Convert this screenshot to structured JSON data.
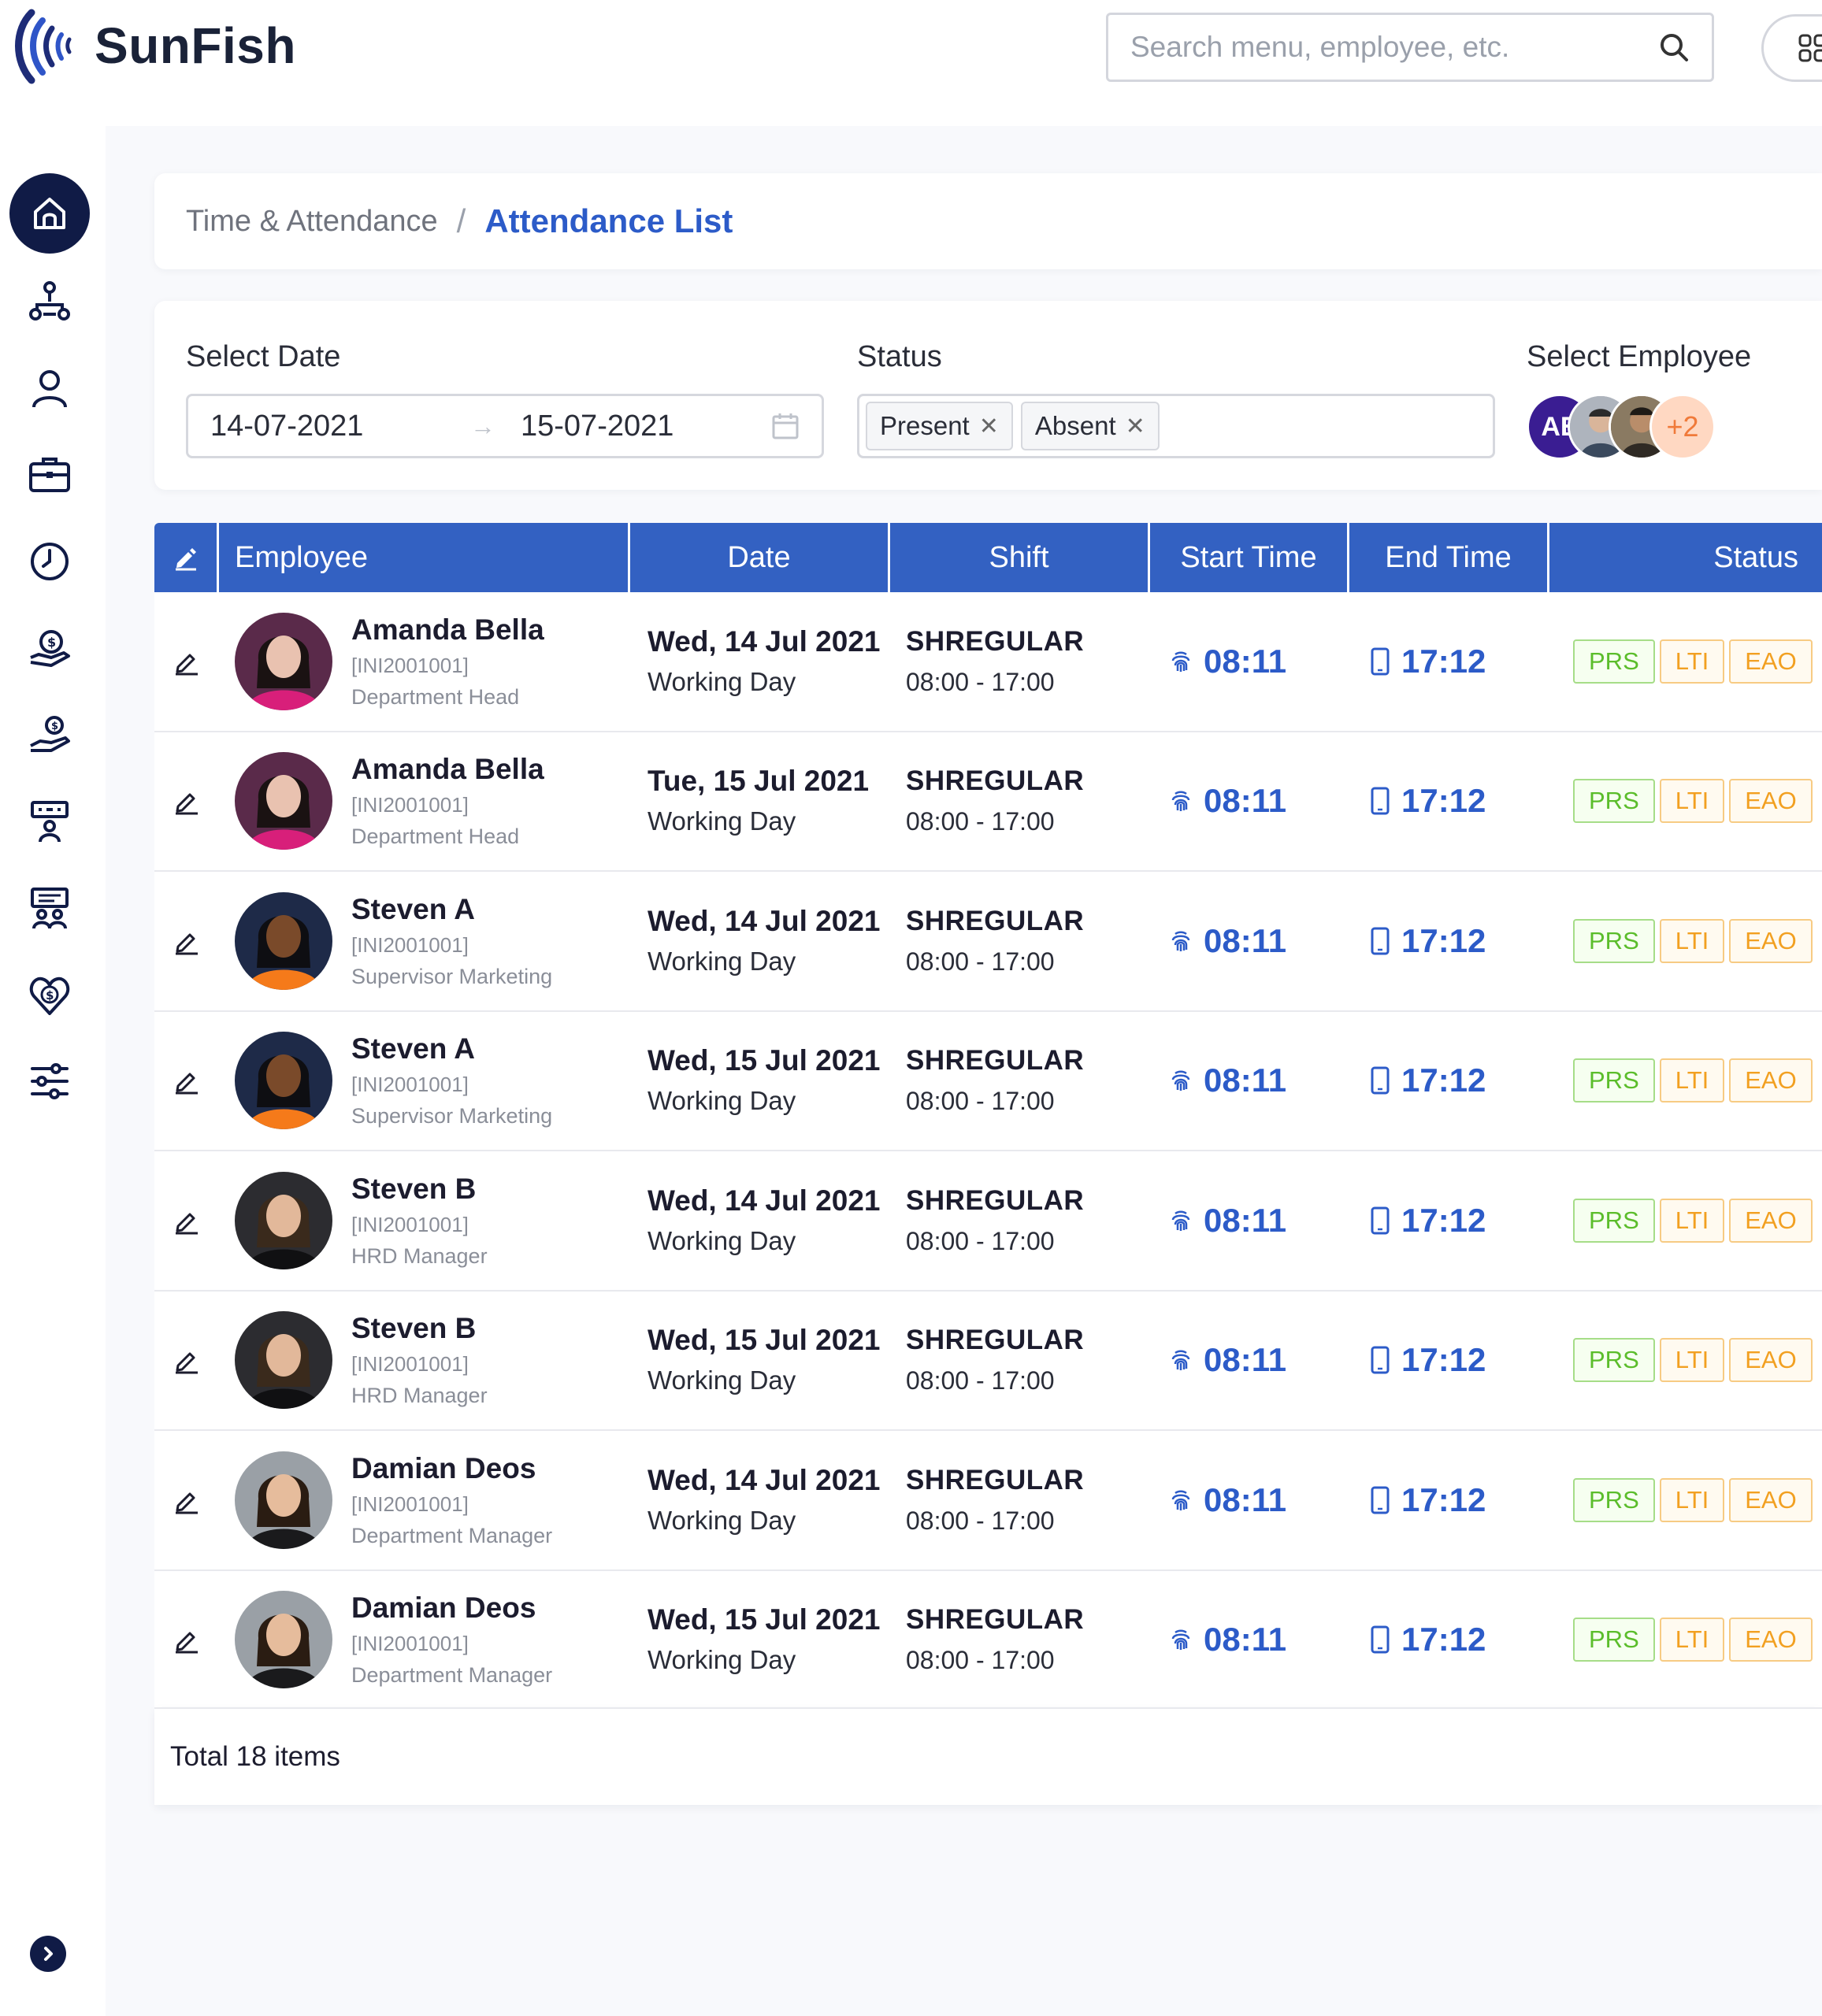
{
  "app": {
    "name": "SunFish"
  },
  "search": {
    "placeholder": "Search menu, employee, etc."
  },
  "breadcrumb": {
    "parent": "Time & Attendance",
    "separator": "/",
    "current": "Attendance List"
  },
  "filters": {
    "date_label": "Select Date",
    "date_from": "14-07-2021",
    "date_to": "15-07-2021",
    "status_label": "Status",
    "status_tags": [
      "Present",
      "Absent"
    ],
    "employee_label": "Select Employee",
    "employee_initials": "AE",
    "employee_more": "+2"
  },
  "table": {
    "headers": {
      "employee": "Employee",
      "date": "Date",
      "shift": "Shift",
      "start": "Start Time",
      "end": "End Time",
      "status": "Status"
    },
    "rows": [
      {
        "name": "Amanda Bella",
        "id": "[INI2001001]",
        "role": "Department Head",
        "date": "Wed, 14 Jul 2021",
        "day_type": "Working Day",
        "shift": "SHREGULAR",
        "shift_hours": "08:00 - 17:00",
        "start": "08:11",
        "end": "17:12",
        "badges": [
          "PRS",
          "LTI",
          "EAO"
        ]
      },
      {
        "name": "Amanda Bella",
        "id": "[INI2001001]",
        "role": "Department Head",
        "date": "Tue, 15 Jul 2021",
        "day_type": "Working Day",
        "shift": "SHREGULAR",
        "shift_hours": "08:00 - 17:00",
        "start": "08:11",
        "end": "17:12",
        "badges": [
          "PRS",
          "LTI",
          "EAO"
        ]
      },
      {
        "name": "Steven A",
        "id": "[INI2001001]",
        "role": "Supervisor Marketing",
        "date": "Wed, 14 Jul 2021",
        "day_type": "Working Day",
        "shift": "SHREGULAR",
        "shift_hours": "08:00 - 17:00",
        "start": "08:11",
        "end": "17:12",
        "badges": [
          "PRS",
          "LTI",
          "EAO"
        ]
      },
      {
        "name": "Steven A",
        "id": "[INI2001001]",
        "role": "Supervisor Marketing",
        "date": "Wed, 15 Jul 2021",
        "day_type": "Working Day",
        "shift": "SHREGULAR",
        "shift_hours": "08:00 - 17:00",
        "start": "08:11",
        "end": "17:12",
        "badges": [
          "PRS",
          "LTI",
          "EAO"
        ]
      },
      {
        "name": "Steven B",
        "id": "[INI2001001]",
        "role": "HRD Manager",
        "date": "Wed, 14 Jul 2021",
        "day_type": "Working Day",
        "shift": "SHREGULAR",
        "shift_hours": "08:00 - 17:00",
        "start": "08:11",
        "end": "17:12",
        "badges": [
          "PRS",
          "LTI",
          "EAO"
        ]
      },
      {
        "name": "Steven B",
        "id": "[INI2001001]",
        "role": "HRD Manager",
        "date": "Wed, 15 Jul 2021",
        "day_type": "Working Day",
        "shift": "SHREGULAR",
        "shift_hours": "08:00 - 17:00",
        "start": "08:11",
        "end": "17:12",
        "badges": [
          "PRS",
          "LTI",
          "EAO"
        ]
      },
      {
        "name": "Damian Deos",
        "id": "[INI2001001]",
        "role": "Department Manager",
        "date": "Wed, 14 Jul 2021",
        "day_type": "Working Day",
        "shift": "SHREGULAR",
        "shift_hours": "08:00 - 17:00",
        "start": "08:11",
        "end": "17:12",
        "badges": [
          "PRS",
          "LTI",
          "EAO"
        ]
      },
      {
        "name": "Damian Deos",
        "id": "[INI2001001]",
        "role": "Department Manager",
        "date": "Wed, 15 Jul 2021",
        "day_type": "Working Day",
        "shift": "SHREGULAR",
        "shift_hours": "08:00 - 17:00",
        "start": "08:11",
        "end": "17:12",
        "badges": [
          "PRS",
          "LTI",
          "EAO"
        ]
      }
    ]
  },
  "footer": {
    "total": "Total 18 items"
  },
  "sidebar": {
    "icons": [
      "home-icon",
      "org-chart-icon",
      "user-icon",
      "briefcase-icon",
      "clock-icon",
      "payroll-icon",
      "benefit-icon",
      "training-icon",
      "recruitment-icon",
      "heart-coin-icon",
      "settings-sliders-icon"
    ]
  },
  "colors": {
    "primary": "#3361c2",
    "navy": "#101b46",
    "accent_text": "#2c5bc8",
    "prs": "#5bbd2b",
    "lti": "#f2a021",
    "eao": "#f2a021"
  }
}
